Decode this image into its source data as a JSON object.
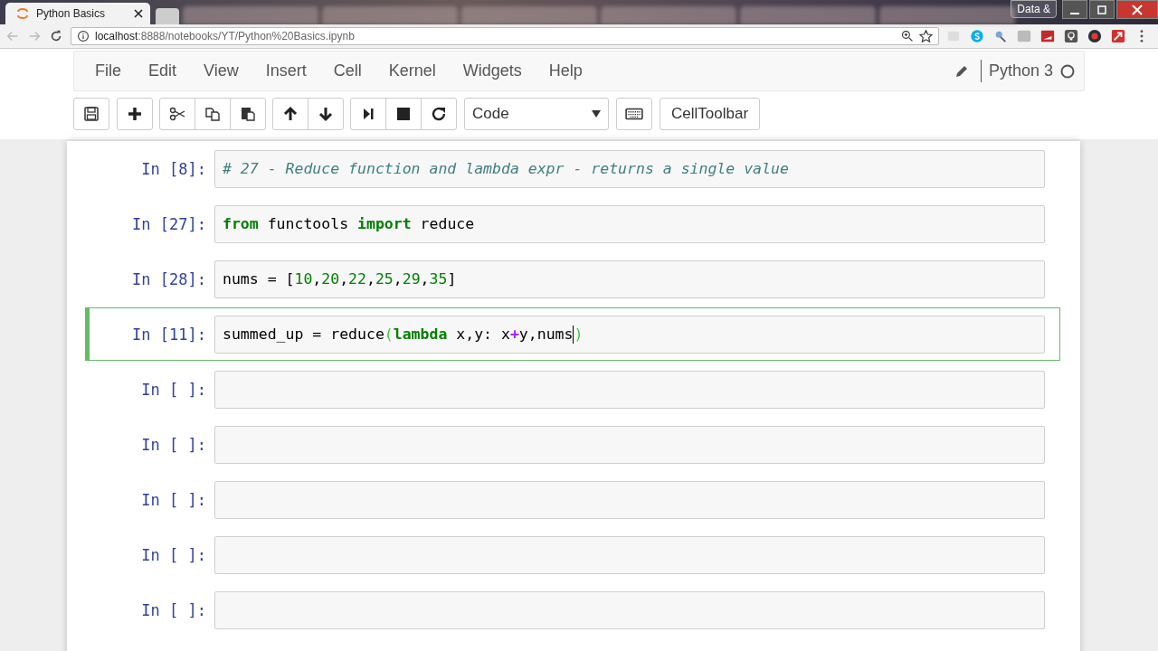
{
  "browser": {
    "tab_title": "Python Basics",
    "url_host": "localhost",
    "url_path": ":8888/notebooks/YT/Python%20Basics.ipynb",
    "profile": "Data &"
  },
  "menubar": {
    "items": [
      "File",
      "Edit",
      "View",
      "Insert",
      "Cell",
      "Kernel",
      "Widgets",
      "Help"
    ],
    "kernel": "Python 3"
  },
  "toolbar": {
    "cell_type": "Code",
    "cell_toolbar": "CellToolbar"
  },
  "cells": [
    {
      "prompt": "In [8]:",
      "selected": false,
      "tokens": [
        {
          "text": "# 27 - Reduce function and lambda expr - returns a single value",
          "kind": "comment"
        }
      ]
    },
    {
      "prompt": "In [27]:",
      "selected": false,
      "tokens": [
        {
          "text": "from",
          "kind": "keyword"
        },
        {
          "text": " functools ",
          "kind": "text"
        },
        {
          "text": "import",
          "kind": "keyword"
        },
        {
          "text": " reduce",
          "kind": "text"
        }
      ]
    },
    {
      "prompt": "In [28]:",
      "selected": false,
      "tokens": [
        {
          "text": "nums = [",
          "kind": "text"
        },
        {
          "text": "10",
          "kind": "number"
        },
        {
          "text": ",",
          "kind": "text"
        },
        {
          "text": "20",
          "kind": "number"
        },
        {
          "text": ",",
          "kind": "text"
        },
        {
          "text": "22",
          "kind": "number"
        },
        {
          "text": ",",
          "kind": "text"
        },
        {
          "text": "25",
          "kind": "number"
        },
        {
          "text": ",",
          "kind": "text"
        },
        {
          "text": "29",
          "kind": "number"
        },
        {
          "text": ",",
          "kind": "text"
        },
        {
          "text": "35",
          "kind": "number"
        },
        {
          "text": "]",
          "kind": "text"
        }
      ]
    },
    {
      "prompt": "In [11]:",
      "selected": true,
      "tokens": [
        {
          "text": "summed_up = reduce",
          "kind": "text"
        },
        {
          "text": "(",
          "kind": "match"
        },
        {
          "text": "lambda",
          "kind": "keyword"
        },
        {
          "text": " x,y: x",
          "kind": "text"
        },
        {
          "text": "+",
          "kind": "operator"
        },
        {
          "text": "y,nums",
          "kind": "text"
        },
        {
          "text": ")",
          "kind": "match"
        }
      ]
    },
    {
      "prompt": "In [ ]:",
      "selected": false
    },
    {
      "prompt": "In [ ]:",
      "selected": false
    },
    {
      "prompt": "In [ ]:",
      "selected": false
    },
    {
      "prompt": "In [ ]:",
      "selected": false
    },
    {
      "prompt": "In [ ]:",
      "selected": false
    }
  ]
}
